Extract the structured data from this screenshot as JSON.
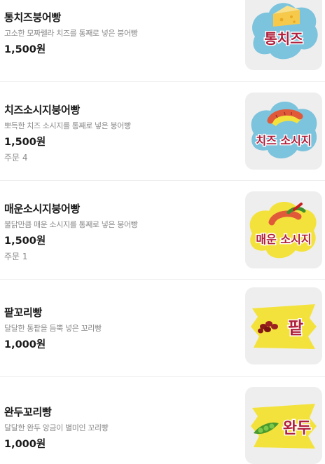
{
  "menu": {
    "items": [
      {
        "name": "통치즈붕어빵",
        "description": "고소한 모짜렐라 치즈를 통째로 넣은 붕어빵",
        "price": "1,500원",
        "orders": "",
        "image_label": "통치즈",
        "image_icon": "cheese-icon",
        "badge_color": "#7cc3dd"
      },
      {
        "name": "치즈소시지붕어빵",
        "description": "뽀득한 치즈 소시지를 통째로 넣은 붕어빵",
        "price": "1,500원",
        "orders": "주문 4",
        "image_label": "치즈 소시지",
        "image_icon": "sausage-icon",
        "badge_color": "#7cc3dd"
      },
      {
        "name": "매운소시지붕어빵",
        "description": "불닭만큼 매운 소시지를 통째로 넣은 붕어빵",
        "price": "1,500원",
        "orders": "주문 1",
        "image_label": "매운 소시지",
        "image_icon": "spicy-sausage-icon",
        "badge_color": "#f4e23c"
      },
      {
        "name": "팥꼬리빵",
        "description": "달달한 통팥을 듬뿍 넣은 꼬리빵",
        "price": "1,000원",
        "orders": "",
        "image_label": "팥",
        "image_icon": "red-bean-icon",
        "badge_color": "#f4e23c"
      },
      {
        "name": "완두꼬리빵",
        "description": "달달한 완두 앙금이 별미인 꼬리빵",
        "price": "1,000원",
        "orders": "",
        "image_label": "완두",
        "image_icon": "pea-icon",
        "badge_color": "#f4e23c"
      }
    ]
  }
}
